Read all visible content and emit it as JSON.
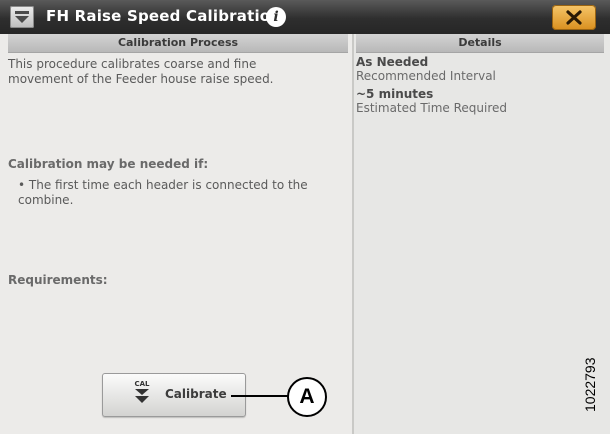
{
  "window": {
    "title": "FH Raise Speed Calibration",
    "info_icon": "info-icon",
    "close_icon": "close-icon"
  },
  "process": {
    "header": "Calibration Process",
    "description": "This procedure calibrates coarse and fine movement of the Feeder house raise speed.",
    "needed_if_heading": "Calibration may be needed if:",
    "needed_if_items": [
      "• The first time each header is connected to the combine."
    ],
    "requirements_heading": "Requirements:",
    "calibrate_icon_text": "CAL",
    "calibrate_label": "Calibrate"
  },
  "details": {
    "header": "Details",
    "items": [
      {
        "value": "As Needed",
        "label": "Recommended Interval"
      },
      {
        "value": "~5 minutes",
        "label": "Estimated Time Required"
      }
    ]
  },
  "annotation": {
    "callout_letter": "A",
    "figure_number": "1022793"
  },
  "colors": {
    "titlebar": "#2e2e2e",
    "close_button": "#e3a23a",
    "background": "#e6e6e4"
  }
}
